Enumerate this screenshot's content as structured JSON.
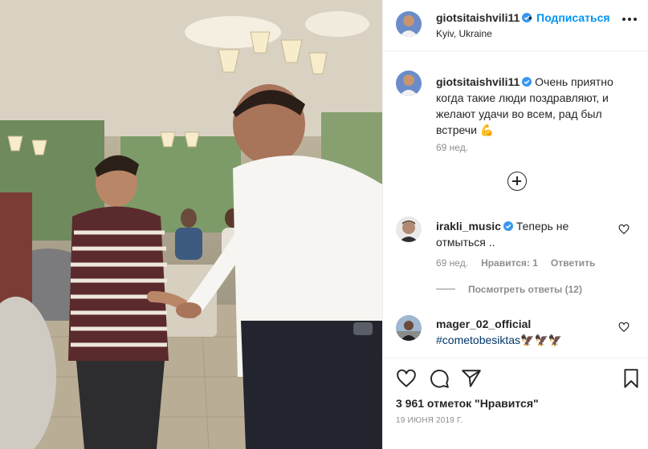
{
  "post": {
    "author": "giotsitaishvili11",
    "follow_label": "Подписаться",
    "location": "Kyiv, Ukraine",
    "separator": "•"
  },
  "caption": {
    "author": "giotsitaishvili11",
    "text": "Очень приятно когда такие люди поздравляют, и желают удачи во всем, рад был встречи",
    "emoji": "💪",
    "time": "69 нед."
  },
  "comments": [
    {
      "author": "irakli_music",
      "text": "Теперь не отмыться ..",
      "time": "69 нед.",
      "likes": "Нравится: 1",
      "reply_label": "Ответить",
      "view_replies": "Посмотреть ответы (12)"
    },
    {
      "author": "mager_02_official",
      "hashtag": "#cometobesiktas",
      "emoji": "🦅🦅🦅"
    }
  ],
  "footer": {
    "likes": "3 961 отметок \"Нравится\"",
    "date": "19 ИЮНЯ 2019 Г."
  },
  "icons": {
    "like": "heart-icon",
    "comment": "comment-icon",
    "share": "share-icon",
    "save": "bookmark-icon",
    "more": "more-icon",
    "add": "plus-circle-icon"
  },
  "colors": {
    "link_blue": "#0095f6",
    "hashtag": "#00376b",
    "muted": "#8e8e8e",
    "text": "#262626"
  }
}
